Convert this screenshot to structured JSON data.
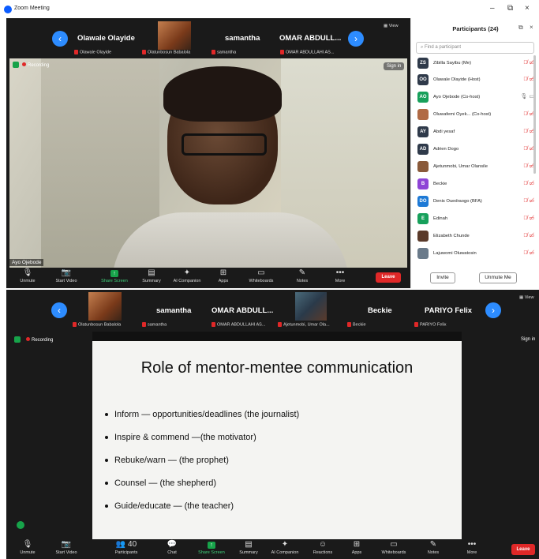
{
  "window": {
    "title": "Zoom Meeting",
    "controls": [
      "–",
      "⧉",
      "×"
    ]
  },
  "top_meeting": {
    "strip_tiles": [
      {
        "name": "Olawale Olayide",
        "label": "Olawale Olayide",
        "kind": "name"
      },
      {
        "name": "",
        "label": "Olatunbosun Babalola",
        "kind": "thumb"
      },
      {
        "name": "samantha",
        "label": "samantha",
        "kind": "name"
      },
      {
        "name": "OMAR  ABDULL...",
        "label": "OMAR ABDULLAHI AS...",
        "kind": "name"
      }
    ],
    "view_label": "View",
    "recording": "Recording",
    "sign_in": "Sign in",
    "speaker_name": "Ayo Ojebode",
    "toolbar": [
      {
        "icon": "🎙",
        "label": "Unmute"
      },
      {
        "icon": "📷",
        "label": "Start Video"
      },
      {
        "icon": "↑",
        "label": "Share Screen"
      },
      {
        "icon": "▤",
        "label": "Summary"
      },
      {
        "icon": "✦",
        "label": "AI Companion"
      },
      {
        "icon": "⊞",
        "label": "Apps"
      },
      {
        "icon": "▭",
        "label": "Whiteboards"
      },
      {
        "icon": "✎",
        "label": "Notes"
      },
      {
        "icon": "•••",
        "label": "More"
      }
    ],
    "leave": "Leave"
  },
  "participants": {
    "title": "Participants (24)",
    "search_placeholder": "Find a participant",
    "rows": [
      {
        "initials": "ZS",
        "color": "#2f3a4a",
        "name": "Zibilla Sayibu (Me)"
      },
      {
        "initials": "OO",
        "color": "#2f3a4a",
        "name": "Olawale Olayide (Host)"
      },
      {
        "initials": "AO",
        "color": "#17a05b",
        "name": "Ayo Ojebode (Co-host)"
      },
      {
        "initials": "",
        "color": "#b06a45",
        "name": "Oluwafemi Oyek... (Co-host)"
      },
      {
        "initials": "AY",
        "color": "#2f3a4a",
        "name": "Abdi yesaf"
      },
      {
        "initials": "AD",
        "color": "#2f3a4a",
        "name": "Adrien Dogo"
      },
      {
        "initials": "",
        "color": "#8a5a3a",
        "name": "Ajetunmobi, Umar Olansile"
      },
      {
        "initials": "B",
        "color": "#8e44d6",
        "name": "Beckie"
      },
      {
        "initials": "DO",
        "color": "#1e7ad6",
        "name": "Denis Ouedraogo (BFA)"
      },
      {
        "initials": "E",
        "color": "#17a05b",
        "name": "Edinah"
      },
      {
        "initials": "",
        "color": "#5a3a2a",
        "name": "Elizabeth Chunde"
      },
      {
        "initials": "",
        "color": "#6a7a8a",
        "name": "Lajuwomi Oluwatosin"
      }
    ],
    "invite": "Invite",
    "unmute_me": "Unmute Me"
  },
  "bottom_meeting": {
    "strip_tiles": [
      {
        "name": "",
        "label": "Olatunbosun Babalola",
        "kind": "thumb"
      },
      {
        "name": "samantha",
        "label": "samantha",
        "kind": "name"
      },
      {
        "name": "OMAR  ABDULL...",
        "label": "OMAR ABDULLAHI AS...",
        "kind": "name"
      },
      {
        "name": "",
        "label": "Ajetunmobi, Umar Ola...",
        "kind": "thumb"
      },
      {
        "name": "Beckie",
        "label": "Beckie",
        "kind": "name"
      },
      {
        "name": "PARIYO Felix",
        "label": "PARIYO Felix",
        "kind": "name"
      }
    ],
    "view_label": "View",
    "recording": "Recording",
    "sign_in": "Sign in",
    "slide": {
      "title": "Role of mentor-mentee communication",
      "bullets": [
        "Inform — opportunities/deadlines (the journalist)",
        "Inspire & commend —(the motivator)",
        "Rebuke/warn — (the prophet)",
        "Counsel — (the shepherd)",
        "Guide/educate — (the teacher)"
      ]
    },
    "toolbar": [
      {
        "icon": "🎙",
        "label": "Unmute"
      },
      {
        "icon": "📷",
        "label": "Start Video"
      },
      {
        "icon": "👥 40",
        "label": "Participants"
      },
      {
        "icon": "💬",
        "label": "Chat"
      },
      {
        "icon": "↑",
        "label": "Share Screen"
      },
      {
        "icon": "▤",
        "label": "Summary"
      },
      {
        "icon": "✦",
        "label": "AI Companion"
      },
      {
        "icon": "☺",
        "label": "Reactions"
      },
      {
        "icon": "⊞",
        "label": "Apps"
      },
      {
        "icon": "▭",
        "label": "Whiteboards"
      },
      {
        "icon": "✎",
        "label": "Notes"
      },
      {
        "icon": "•••",
        "label": "More"
      }
    ],
    "leave": "Leave"
  }
}
